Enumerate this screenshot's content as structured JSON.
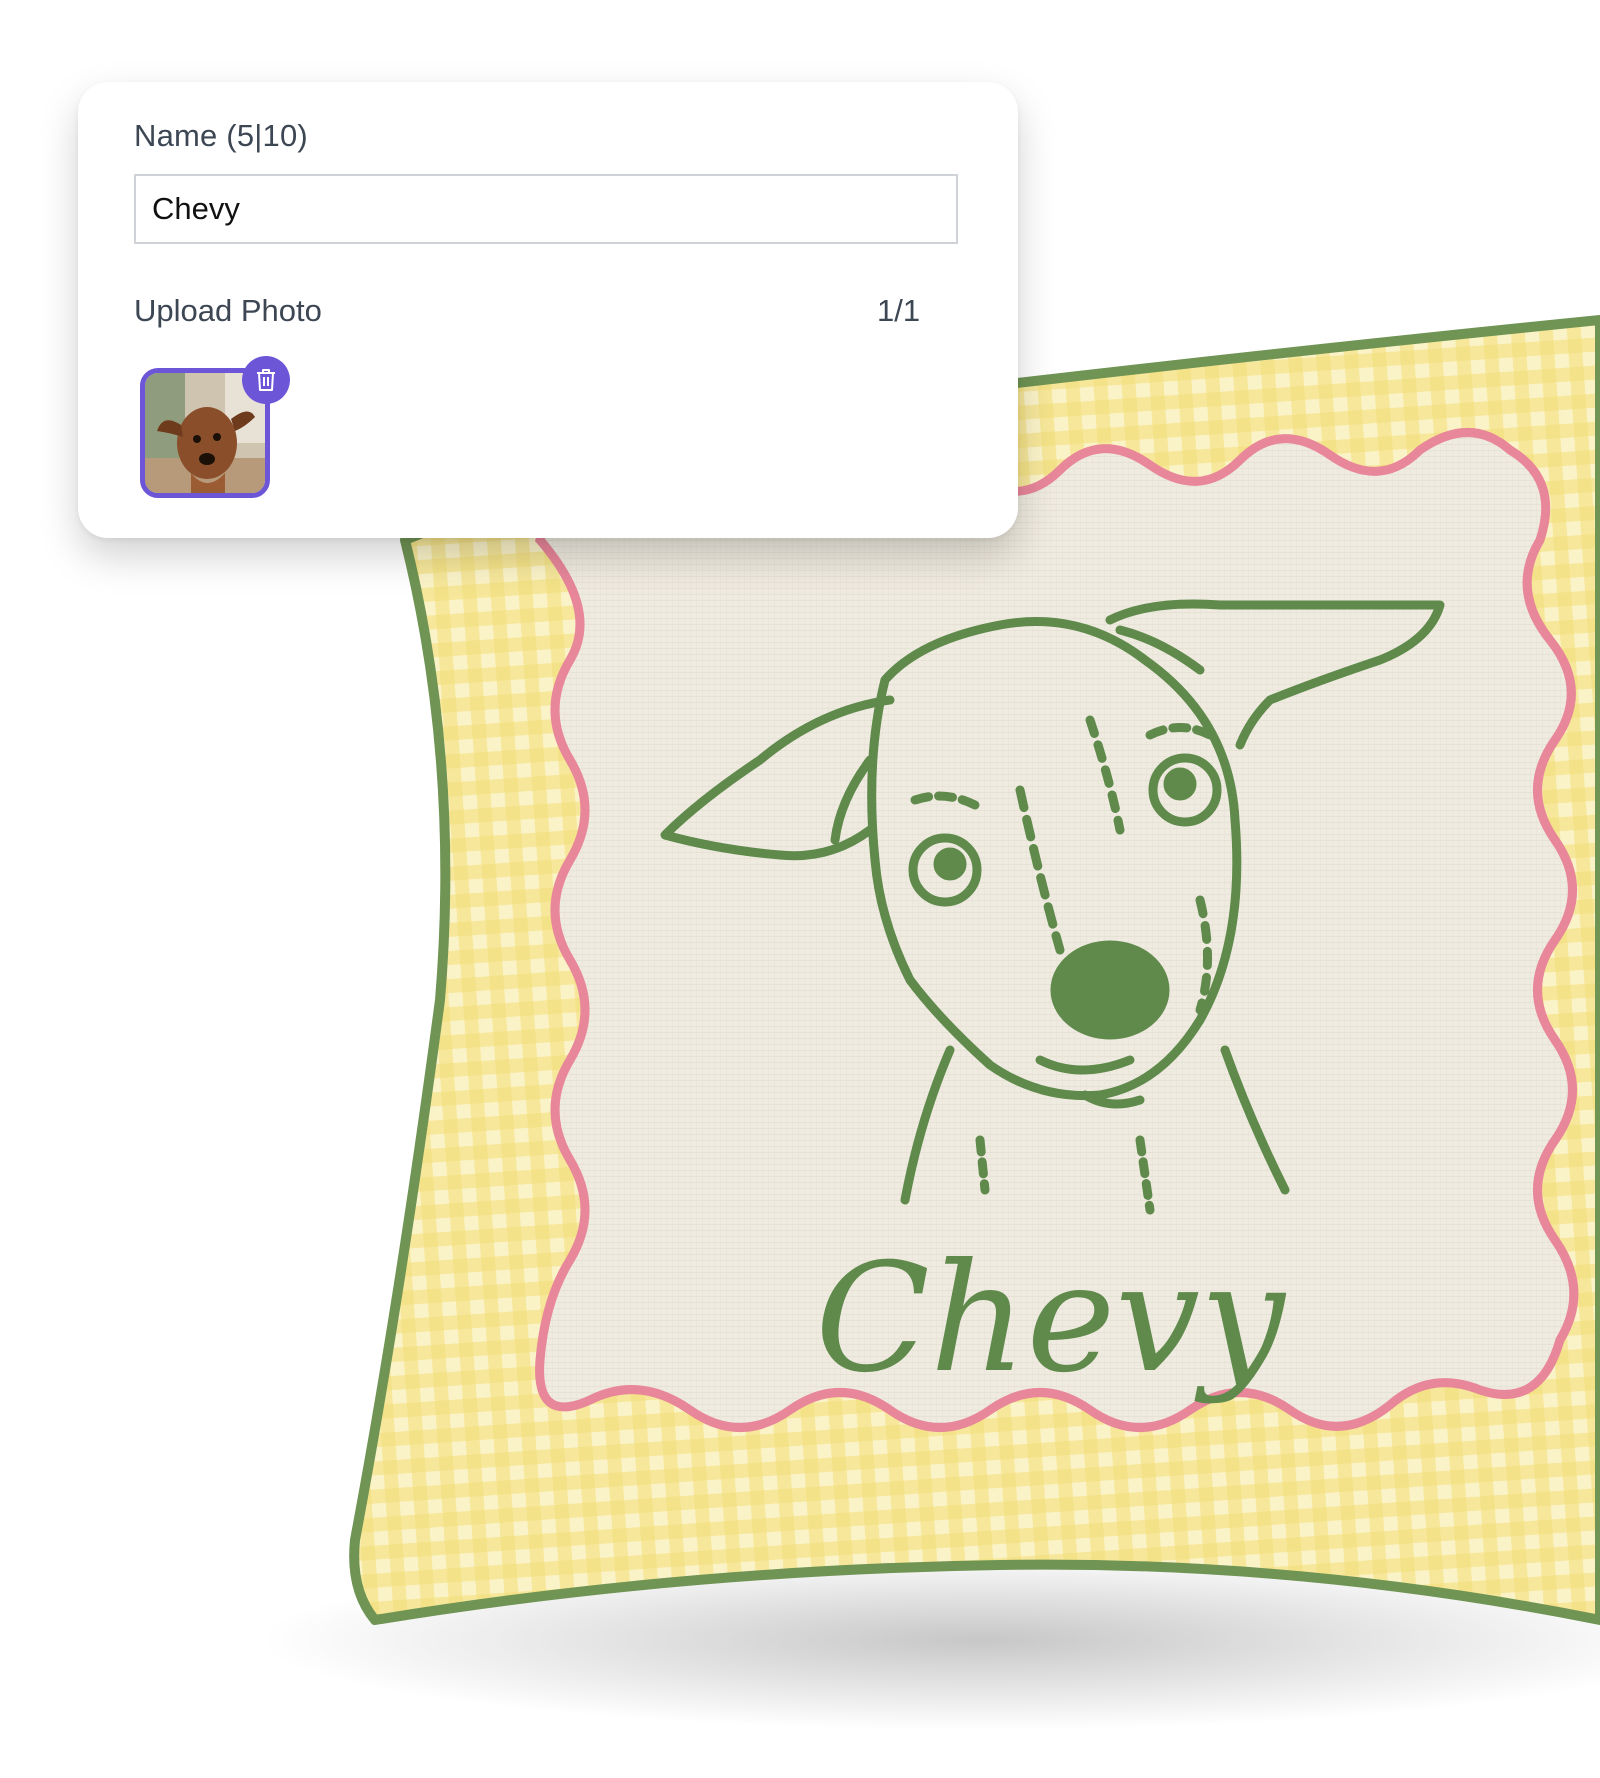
{
  "product": {
    "pillow_name_text": "Chevy",
    "colors": {
      "gingham_base": "#f6e9a6",
      "gingham_stripe": "#f3db6c",
      "piping": "#6f9454",
      "scallop_border": "#e8869a",
      "linen": "#ede9dd",
      "illustration": "#5f8a4c"
    }
  },
  "form": {
    "name_label": "Name (5|10)",
    "name_value": "Chevy",
    "upload_label": "Upload Photo",
    "upload_count": "1/1",
    "accent_color": "#6d55d8",
    "icons": {
      "delete": "trash-icon",
      "thumbnail": "dog-photo"
    }
  }
}
